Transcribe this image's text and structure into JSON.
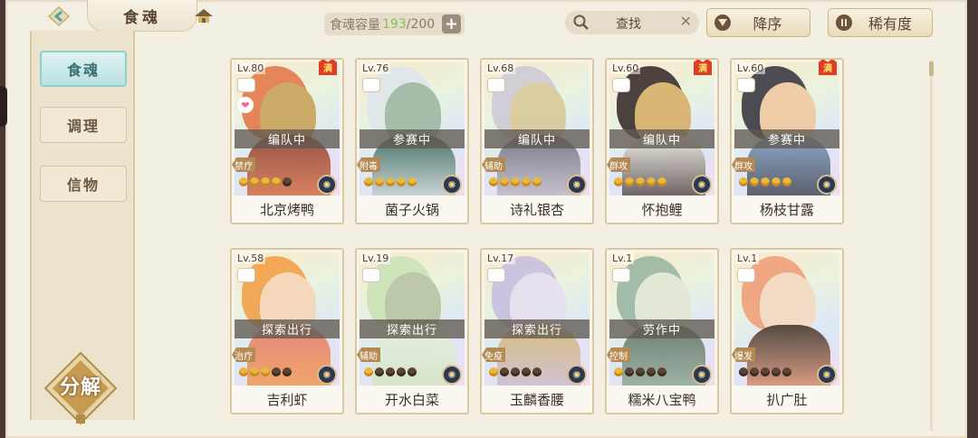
{
  "header": {
    "title": "食魂",
    "capacity_label": "食魂容量",
    "capacity_current": "193",
    "capacity_sep_max": "/200",
    "add_label": "+",
    "search_label": "查找",
    "search_clear": "✕",
    "sort_label": "降序",
    "rarity_label": "稀有度"
  },
  "sidebar": {
    "items": [
      {
        "label": "食魂",
        "active": true
      },
      {
        "label": "调理",
        "active": false
      },
      {
        "label": "信物",
        "active": false
      }
    ],
    "decompose_label": "分解"
  },
  "colors": {
    "accent_teal": "#8fcfcc",
    "gold": "#cdb283",
    "status_bar": "#605850"
  },
  "cards": [
    {
      "level": "Lv.80",
      "status": "编队中",
      "role": "禁疗",
      "name": "北京烤鸭",
      "max": true,
      "heart": true,
      "stars": 4,
      "art": [
        "#e37a4a",
        "#8a3a2a",
        "#c9a25a"
      ]
    },
    {
      "level": "Lv.76",
      "status": "参赛中",
      "role": "附毒",
      "name": "菌子火锅",
      "max": false,
      "heart": false,
      "stars": 5,
      "art": [
        "#dfe6ea",
        "#2f5f4f",
        "#9fb7a3"
      ]
    },
    {
      "level": "Lv.68",
      "status": "编队中",
      "role": "辅助",
      "name": "诗礼银杏",
      "max": false,
      "heart": false,
      "stars": 5,
      "art": [
        "#cfcad6",
        "#6c6878",
        "#d9c99a"
      ]
    },
    {
      "level": "Lv.60",
      "status": "编队中",
      "role": "群攻",
      "name": "怀抱鲤",
      "max": true,
      "heart": false,
      "stars": 5,
      "art": [
        "#3b2f2f",
        "#f2ede2",
        "#d8b06a"
      ]
    },
    {
      "level": "Lv.60",
      "status": "参赛中",
      "role": "群攻",
      "name": "杨枝甘露",
      "max": true,
      "heart": false,
      "stars": 5,
      "art": [
        "#3a3a44",
        "#7d9cc0",
        "#f0c9a0"
      ]
    },
    {
      "level": "Lv.58",
      "status": "探索出行",
      "role": "治疗",
      "name": "吉利虾",
      "max": false,
      "heart": false,
      "stars": 3,
      "art": [
        "#f2a14a",
        "#e7776a",
        "#f7d6b8"
      ]
    },
    {
      "level": "Lv.19",
      "status": "探索出行",
      "role": "辅助",
      "name": "开水白菜",
      "max": false,
      "heart": false,
      "stars": 1,
      "art": [
        "#cde3b9",
        "#e9f0e2",
        "#b7c4a4"
      ]
    },
    {
      "level": "Lv.17",
      "status": "探索出行",
      "role": "免疫",
      "name": "玉麟香腰",
      "max": false,
      "heart": false,
      "stars": 1,
      "art": [
        "#c8bfe0",
        "#d9b46a",
        "#e6dff1"
      ]
    },
    {
      "level": "Lv.1",
      "status": "劳作中",
      "role": "控制",
      "name": "糯米八宝鸭",
      "max": false,
      "heart": false,
      "stars": 1,
      "art": [
        "#9ab7a4",
        "#5d6b5a",
        "#e2e7d6"
      ]
    },
    {
      "level": "Lv.1",
      "status": "",
      "role": "爆发",
      "name": "扒广肚",
      "max": false,
      "heart": false,
      "stars": 0,
      "art": [
        "#f0a07a",
        "#3d2f2a",
        "#f4d9c2"
      ]
    }
  ]
}
